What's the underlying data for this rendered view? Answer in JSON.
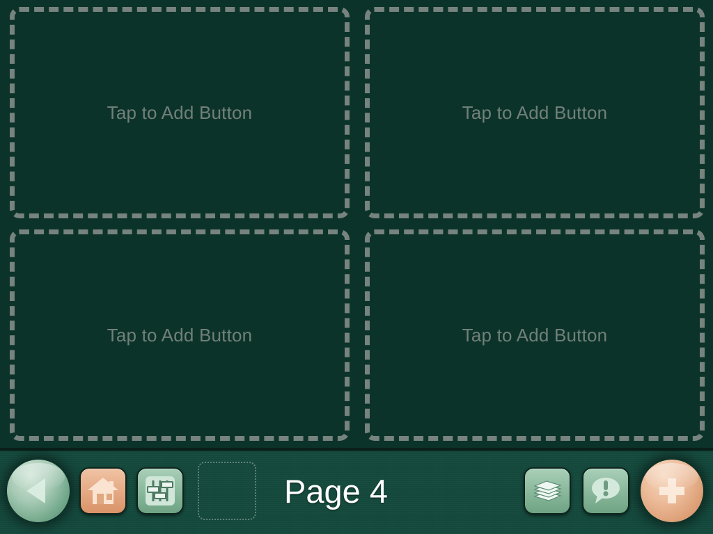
{
  "app": {
    "background_color": "#0c3329",
    "toolbar_color": "#14493c"
  },
  "grid": {
    "rows": 2,
    "columns": 2,
    "cells": [
      {
        "label": "Tap to Add Button",
        "state": "empty"
      },
      {
        "label": "Tap to Add Button",
        "state": "empty"
      },
      {
        "label": "Tap to Add Button",
        "state": "empty"
      },
      {
        "label": "Tap to Add Button",
        "state": "empty"
      }
    ]
  },
  "toolbar": {
    "back_button": {
      "name": "back-button",
      "icon": "triangle-left-icon",
      "color": "#a8cbb6"
    },
    "home_button": {
      "name": "home-button",
      "icon": "house-icon",
      "color": "#e6ab86"
    },
    "settings_button": {
      "name": "settings-button",
      "icon": "sliders-icon",
      "color": "#8cba9e"
    },
    "mini_placeholder": {
      "name": "empty-slot-placeholder"
    },
    "page_label": "Page 4",
    "pages_button": {
      "name": "pages-button",
      "icon": "page-stack-icon",
      "color": "#8cba9e"
    },
    "alert_button": {
      "name": "alert-button",
      "icon": "speech-bubble-exclamation-icon",
      "color": "#8cba9e"
    },
    "add_button": {
      "name": "add-button",
      "icon": "plus-icon",
      "color": "#edbd9c"
    }
  }
}
